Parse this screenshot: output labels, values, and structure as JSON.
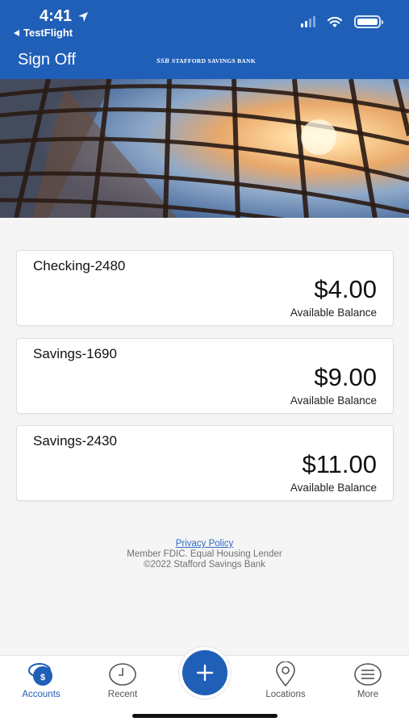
{
  "status_bar": {
    "time": "4:41",
    "back_app": "TestFlight"
  },
  "header": {
    "sign_off_label": "Sign Off",
    "bank_logo_mark": "SSB",
    "bank_logo_text": "STAFFORD SAVINGS BANK"
  },
  "accounts": [
    {
      "name": "Checking-2480",
      "balance": "$4.00",
      "balance_label": "Available Balance"
    },
    {
      "name": "Savings-1690",
      "balance": "$9.00",
      "balance_label": "Available Balance"
    },
    {
      "name": "Savings-2430",
      "balance": "$11.00",
      "balance_label": "Available Balance"
    }
  ],
  "footer": {
    "privacy_policy": "Privacy Policy",
    "member_line": "Member FDIC. Equal Housing Lender",
    "copyright": "©2022 Stafford Savings Bank"
  },
  "tabbar": {
    "items": [
      {
        "label": "Accounts",
        "icon": "accounts-dollar-icon",
        "active": true
      },
      {
        "label": "Recent",
        "icon": "clock-icon",
        "active": false
      },
      {
        "label": "",
        "icon": "plus-icon",
        "active": false
      },
      {
        "label": "Locations",
        "icon": "map-pin-icon",
        "active": false
      },
      {
        "label": "More",
        "icon": "menu-icon",
        "active": false
      }
    ]
  },
  "colors": {
    "brand_blue": "#1f5fb8",
    "link_blue": "#2b6ac3",
    "background": "#f5f5f6"
  }
}
